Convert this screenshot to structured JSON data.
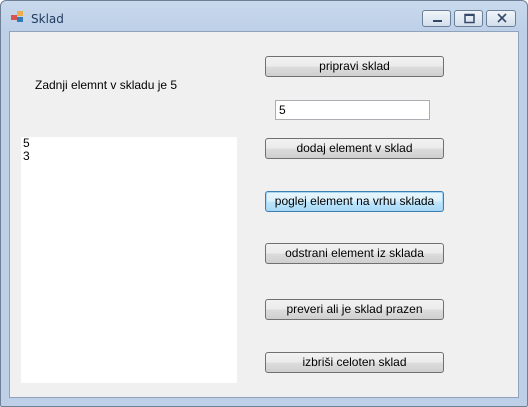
{
  "window": {
    "title": "Sklad",
    "controls": {
      "minimize": "▭",
      "maximize": "□",
      "close": "✕"
    }
  },
  "status_label": "Zadnji elemnt v skladu je 5",
  "input_value": "5",
  "stack_items": [
    "5",
    "3"
  ],
  "buttons": {
    "prepare": "pripravi sklad",
    "add": "dodaj element v sklad",
    "peek": "poglej element na vrhu sklada",
    "remove": "odstrani element iz sklada",
    "check_empty": "preveri ali je sklad prazen",
    "clear": "izbriši celoten sklad"
  },
  "icons": [
    "app-icon",
    "minimize-icon",
    "maximize-icon",
    "close-icon"
  ]
}
